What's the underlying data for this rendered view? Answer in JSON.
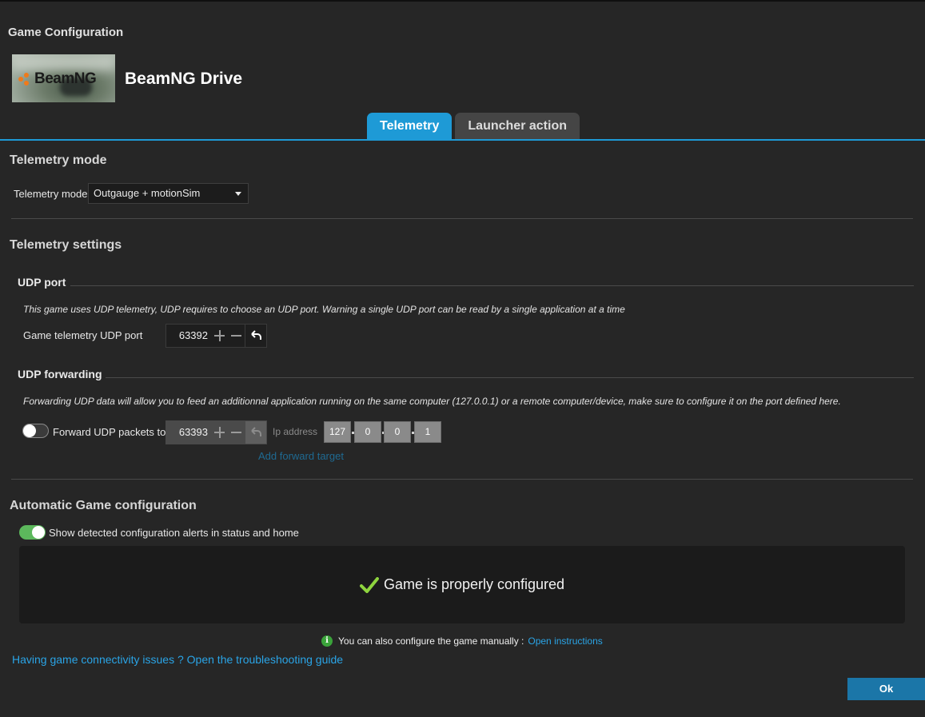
{
  "window": {
    "title": "Game Configuration"
  },
  "game": {
    "name": "BeamNG Drive",
    "thumbnail_text": "BeamNG"
  },
  "tabs": [
    {
      "label": "Telemetry",
      "active": true
    },
    {
      "label": "Launcher action",
      "active": false
    }
  ],
  "telemetry_mode": {
    "section_title": "Telemetry mode",
    "field_label": "Telemetry mode",
    "selected": "Outgauge + motionSim"
  },
  "telemetry_settings": {
    "section_title": "Telemetry settings",
    "udp_port": {
      "title": "UDP port",
      "note": "This game uses UDP telemetry, UDP requires to choose an UDP port. Warning a single UDP port can be read by a single application at a time",
      "field_label": "Game telemetry UDP port",
      "value": "63392"
    },
    "udp_forwarding": {
      "title": "UDP forwarding",
      "note": "Forwarding UDP data will allow you to feed an additionnal application running on the same computer (127.0.0.1) or a remote computer/device, make sure to configure it on the port defined here.",
      "toggle_label": "Forward UDP packets to",
      "toggle_on": false,
      "port_value": "63393",
      "ip_label": "Ip address",
      "ip": [
        "127",
        "0",
        "0",
        "1"
      ],
      "add_target": "Add forward target"
    }
  },
  "auto_config": {
    "section_title": "Automatic Game configuration",
    "toggle_label": "Show detected configuration alerts in status and home",
    "toggle_on": true,
    "status": "Game is properly configured",
    "manual_text": "You can also configure the game manually :",
    "manual_link": "Open instructions"
  },
  "troubleshoot_link": "Having game connectivity issues ? Open the troubleshooting guide",
  "ok_label": "Ok",
  "colors": {
    "accent": "#1e9ad6",
    "success": "#5cb85c",
    "link": "#2aa4e6",
    "background": "#262626"
  }
}
